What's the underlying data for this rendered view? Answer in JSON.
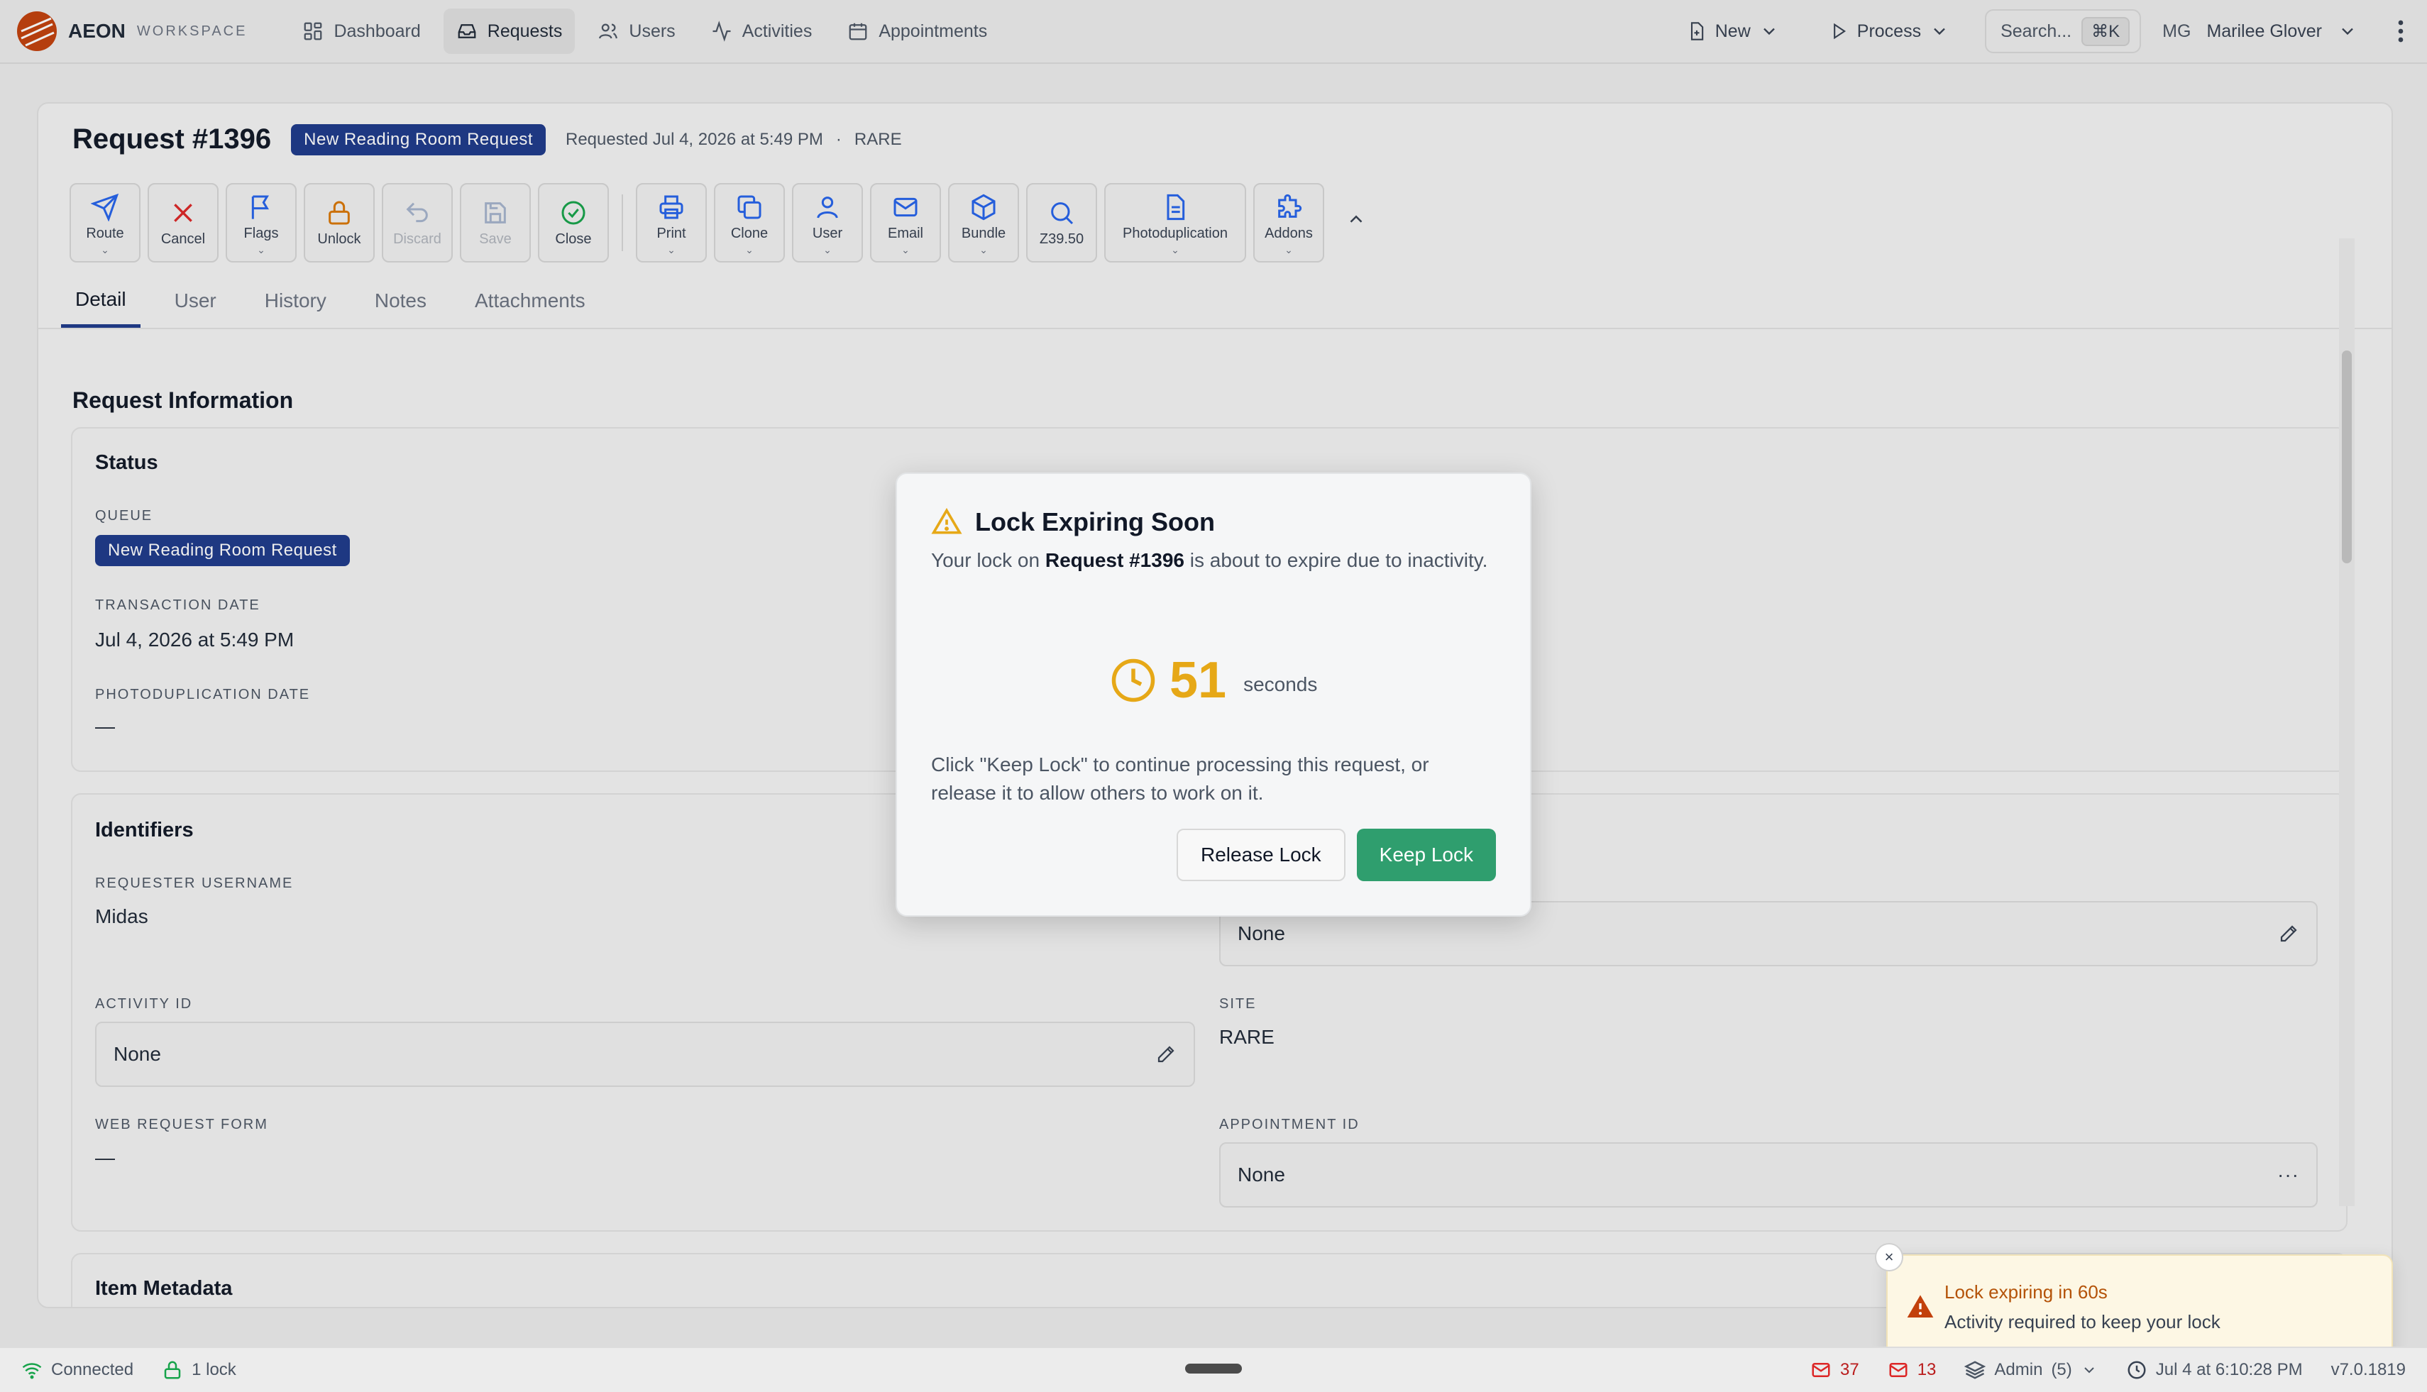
{
  "brand": {
    "name": "AEON",
    "sub": "WORKSPACE"
  },
  "nav": [
    {
      "label": "Dashboard"
    },
    {
      "label": "Requests"
    },
    {
      "label": "Users"
    },
    {
      "label": "Activities"
    },
    {
      "label": "Appointments"
    }
  ],
  "top": {
    "new_label": "New",
    "process_label": "Process",
    "search_label": "Search...",
    "search_kbd": "⌘K",
    "user_initials": "MG",
    "user_name": "Marilee Glover"
  },
  "request": {
    "title": "Request #1396",
    "queue_badge": "New Reading Room Request",
    "requested": "Requested Jul 4, 2026 at 5:49 PM",
    "dot": "·",
    "site": "RARE"
  },
  "toolbar": [
    {
      "label": "Route",
      "icon": "send-icon"
    },
    {
      "label": "Cancel",
      "icon": "x-icon"
    },
    {
      "label": "Flags",
      "icon": "flag-icon"
    },
    {
      "label": "Unlock",
      "icon": "lock-icon"
    },
    {
      "label": "Discard",
      "icon": "undo-icon"
    },
    {
      "label": "Save",
      "icon": "save-icon"
    },
    {
      "label": "Close",
      "icon": "check-circle-icon"
    },
    {
      "label": "Print",
      "icon": "printer-icon"
    },
    {
      "label": "Clone",
      "icon": "copy-icon"
    },
    {
      "label": "User",
      "icon": "user-icon"
    },
    {
      "label": "Email",
      "icon": "mail-icon"
    },
    {
      "label": "Bundle",
      "icon": "box-icon"
    },
    {
      "label": "Z39.50",
      "icon": "search-icon"
    },
    {
      "label": "Photoduplication",
      "icon": "document-icon"
    },
    {
      "label": "Addons",
      "icon": "puzzle-icon"
    }
  ],
  "tabs": [
    {
      "label": "Detail"
    },
    {
      "label": "User"
    },
    {
      "label": "History"
    },
    {
      "label": "Notes"
    },
    {
      "label": "Attachments"
    }
  ],
  "detail": {
    "section_title": "Request Information",
    "status": {
      "title": "Status",
      "queue_label": "QUEUE",
      "queue_value": "New Reading Room Request",
      "transaction_label": "TRANSACTION DATE",
      "transaction_value": "Jul 4, 2026 at 5:49 PM",
      "photodup_label": "PHOTODUPLICATION DATE",
      "photodup_value": "—"
    },
    "identifiers": {
      "title": "Identifiers",
      "requester_label": "REQUESTER USERNAME",
      "requester_value": "Midas",
      "right_top_value": "None",
      "activity_label": "ACTIVITY ID",
      "activity_value": "None",
      "site_label": "SITE",
      "site_value": "RARE",
      "webform_label": "WEB REQUEST FORM",
      "webform_value": "—",
      "appointment_label": "APPOINTMENT ID",
      "appointment_value": "None",
      "appointment_more": "···"
    },
    "next_section": "Item Metadata"
  },
  "modal": {
    "title": "Lock Expiring Soon",
    "body_pre": "Your lock on ",
    "body_bold": "Request #1396",
    "body_post": " is about to expire due to inactivity.",
    "count": "51",
    "count_unit": "seconds",
    "note": "Click \"Keep Lock\" to continue processing this request, or release it to allow others to work on it.",
    "release_label": "Release Lock",
    "keep_label": "Keep Lock"
  },
  "toast": {
    "close": "×",
    "title": "Lock expiring in 60s",
    "sub": "Activity required to keep your lock"
  },
  "statusbar": {
    "connected": "Connected",
    "locks": "1 lock",
    "mail_count_1": "37",
    "mail_count_2": "13",
    "admin": "Admin",
    "admin_count": "(5)",
    "clock": "Jul 4 at 6:10:28 PM",
    "version": "v7.0.1819"
  },
  "colors": {
    "accent_navy": "#1e3a8a",
    "keep_green": "#2f9e6e",
    "countdown_amber": "#e6a817",
    "toast_title": "#b45309",
    "cancel_red": "#dc2626",
    "unlock_orange": "#d97706",
    "close_green": "#16a34a",
    "toolbar_blue": "#2563eb"
  }
}
